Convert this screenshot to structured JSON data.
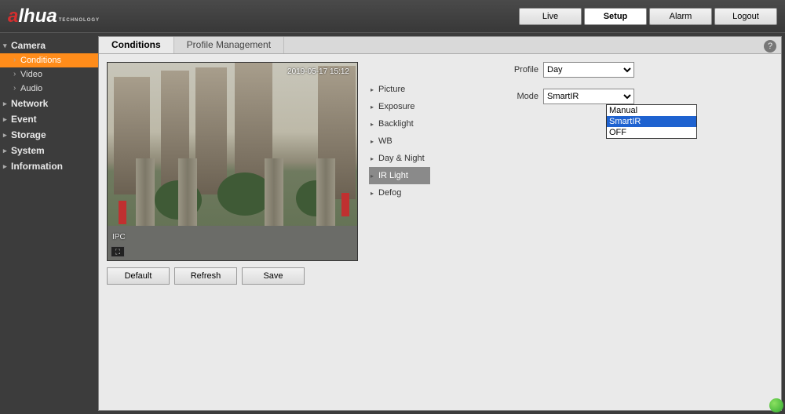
{
  "brand": {
    "name_front": "a",
    "name_rest": "lhua",
    "sub": "TECHNOLOGY"
  },
  "topnav": {
    "live": "Live",
    "setup": "Setup",
    "alarm": "Alarm",
    "logout": "Logout"
  },
  "sidebar": {
    "camera": "Camera",
    "camera_items": {
      "conditions": "Conditions",
      "video": "Video",
      "audio": "Audio"
    },
    "network": "Network",
    "event": "Event",
    "storage": "Storage",
    "system": "System",
    "information": "Information"
  },
  "tabs": {
    "conditions": "Conditions",
    "profile_mgmt": "Profile Management"
  },
  "preview": {
    "timestamp": "2019-05-17 15:12",
    "badge": "IPC",
    "fullscreen_glyph": "⛶"
  },
  "buttons": {
    "default": "Default",
    "refresh": "Refresh",
    "save": "Save"
  },
  "settings": {
    "picture": "Picture",
    "exposure": "Exposure",
    "backlight": "Backlight",
    "wb": "WB",
    "day_night": "Day & Night",
    "ir_light": "IR Light",
    "defog": "Defog"
  },
  "config": {
    "profile_label": "Profile",
    "profile_value": "Day",
    "mode_label": "Mode",
    "mode_value": "SmartIR",
    "mode_options": [
      "Manual",
      "SmartIR",
      "OFF"
    ]
  },
  "help_glyph": "?"
}
